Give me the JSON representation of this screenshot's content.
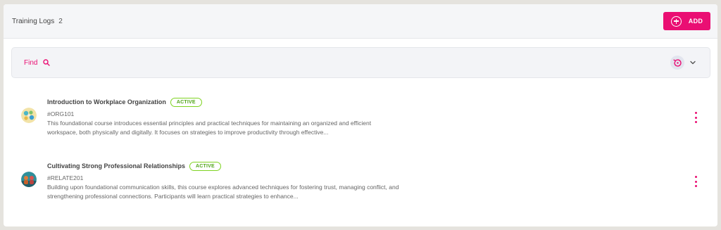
{
  "header": {
    "title": "Training Logs",
    "count": "2",
    "add_label": "ADD"
  },
  "filter": {
    "find_label": "Find"
  },
  "items": [
    {
      "title": "Introduction to Workplace Organization",
      "status": "ACTIVE",
      "code": "#ORG101",
      "description": "This foundational course introduces essential principles and practical techniques for maintaining an organized and efficient workspace, both physically and digitally. It focuses on strategies to improve productivity through effective..."
    },
    {
      "title": "Cultivating Strong Professional Relationships",
      "status": "ACTIVE",
      "code": "#RELATE201",
      "description": "Building upon foundational communication skills, this course explores advanced techniques for fostering trust, managing conflict, and strengthening professional connections. Participants will learn practical strategies to enhance..."
    }
  ],
  "icons": {
    "add": "plus-circle-icon",
    "find": "search-icon",
    "history": "history-icon",
    "expand": "chevron-down-icon",
    "more": "more-vertical-icon"
  },
  "colors": {
    "accent": "#ea0f73",
    "active_badge": "#7ed321",
    "background": "#e5e3de"
  }
}
